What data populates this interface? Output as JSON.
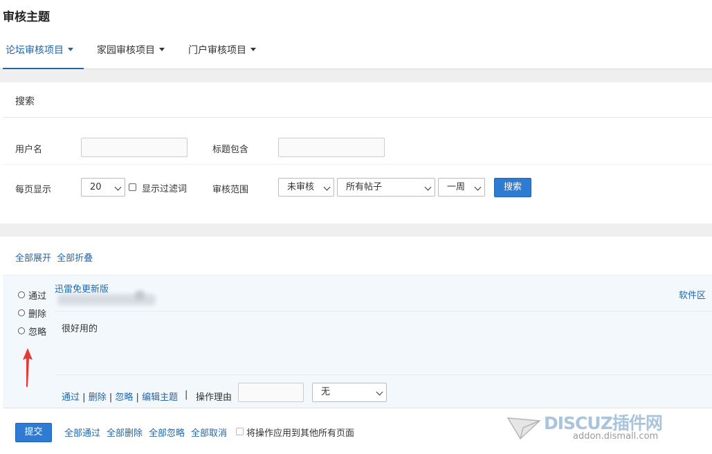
{
  "page": {
    "title": "审核主题"
  },
  "tabs": [
    {
      "label": "论坛审核项目",
      "active": true
    },
    {
      "label": "家园审核项目",
      "active": false
    },
    {
      "label": "门户审核项目",
      "active": false
    }
  ],
  "search": {
    "header": "搜索",
    "username_label": "用户名",
    "username_value": "",
    "title_contains_label": "标题包含",
    "title_contains_value": "",
    "per_page_label": "每页显示",
    "per_page_value": "20",
    "show_filtered_label": "显示过滤词",
    "show_filtered_checked": false,
    "scope_label": "审核范围",
    "status_value": "未审核",
    "posts_value": "所有帖子",
    "period_value": "一周",
    "search_button": "搜索"
  },
  "list": {
    "expand_all": "全部展开",
    "collapse_all": "全部折叠",
    "items": [
      {
        "title": "迅雷免更新版",
        "forum": "软件区",
        "content": "很好用的",
        "options": [
          "通过",
          "删除",
          "忽略"
        ],
        "actions": [
          "通过",
          "删除",
          "忽略",
          "编辑主题"
        ],
        "separator": "|",
        "reason_label": "操作理由",
        "reason_value": "",
        "reason_select": "无"
      }
    ]
  },
  "footer": {
    "submit_button": "提交",
    "approve_all": "全部通过",
    "delete_all": "全部删除",
    "ignore_all": "全部忽略",
    "cancel_all": "全部取消",
    "apply_all_pages_label": "将操作应用到其他所有页面",
    "apply_all_pages_checked": false
  },
  "watermark": {
    "brand": "DISCUZ插件网",
    "url": "addon.dismall.com"
  },
  "colors": {
    "link": "#2366a8",
    "primary_button": "#2d7bd3",
    "item_background": "#f2f8fc",
    "annotation_arrow": "#e53935"
  }
}
